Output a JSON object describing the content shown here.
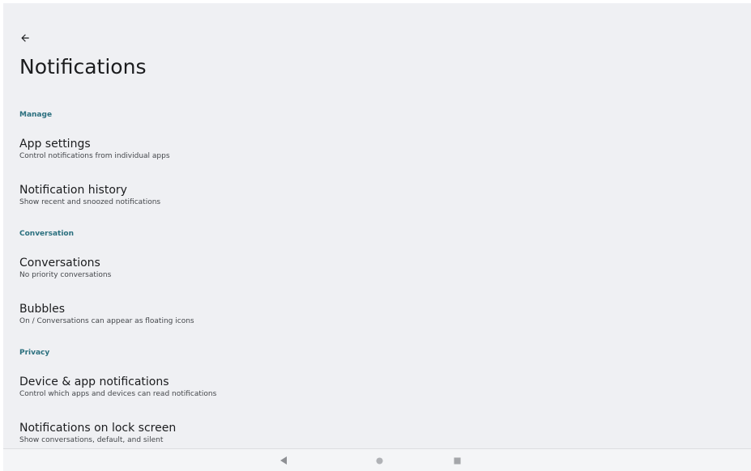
{
  "header": {
    "title": "Notifications",
    "back_icon": "arrow-back-icon"
  },
  "sections": [
    {
      "header": "Manage",
      "items": [
        {
          "title": "App settings",
          "summary": "Control notifications from individual apps"
        },
        {
          "title": "Notification history",
          "summary": "Show recent and snoozed notifications"
        }
      ]
    },
    {
      "header": "Conversation",
      "items": [
        {
          "title": "Conversations",
          "summary": "No priority conversations"
        },
        {
          "title": "Bubbles",
          "summary": "On / Conversations can appear as floating icons"
        }
      ]
    },
    {
      "header": "Privacy",
      "items": [
        {
          "title": "Device & app notifications",
          "summary": "Control which apps and devices can read notifications"
        },
        {
          "title": "Notifications on lock screen",
          "summary": "Show conversations, default, and silent"
        }
      ]
    }
  ],
  "nav_bar": {
    "back_icon": "nav-back-triangle-icon",
    "home_icon": "nav-home-circle-icon",
    "recents_icon": "nav-recents-square-icon"
  },
  "colors": {
    "background": "#eff0f3",
    "section_header": "#2a6f7e",
    "title_text": "#1b1c1e",
    "summary_text": "#44474b"
  }
}
